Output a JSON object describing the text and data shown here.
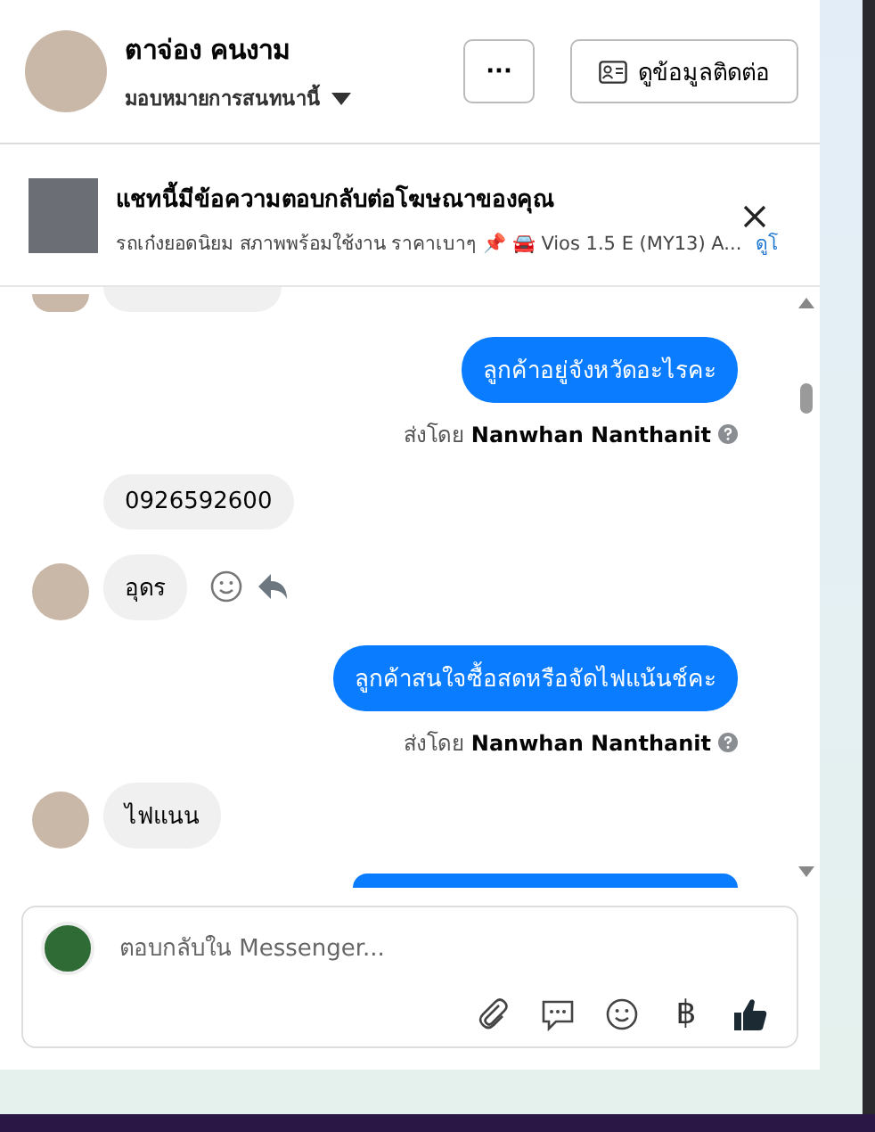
{
  "header": {
    "name": "ตาจ่อง คนงาม",
    "assign_label": "มอบหมายการสนทนานี้",
    "more_button": "···",
    "contact_button": "ดูข้อมูลติดต่อ"
  },
  "ad_banner": {
    "title": "แชทนี้มีข้อความตอบกลับต่อโฆษณาของคุณ",
    "subtitle": "รถเก๋งยอดนิยม สภาพพร้อมใช้งาน ราคาเบาๆ 📌 🚘 Vios 1.5 E (MY13) A...",
    "link": "ดูโ"
  },
  "messages": [
    {
      "kind": "incoming",
      "partial": true,
      "avatar": true
    },
    {
      "kind": "outgoing",
      "text": "ลูกค้าอยู่จังหวัดอะไรคะ",
      "sent_by": "ส่งโดย **Nanwhan Nanthanit**"
    },
    {
      "kind": "incoming",
      "text": "0926592600",
      "avatar": false
    },
    {
      "kind": "incoming",
      "text": "อุดร",
      "avatar": true,
      "actions": true
    },
    {
      "kind": "outgoing",
      "text": "ลูกค้าสนใจซื้อสดหรือจัดไฟแน้นช์คะ",
      "sent_by": "ส่งโดย **Nanwhan Nanthanit**"
    },
    {
      "kind": "incoming",
      "text": "ไฟแนน",
      "avatar": true
    },
    {
      "kind": "outgoing",
      "partial": true
    }
  ],
  "composer": {
    "placeholder": "ตอบกลับใน Messenger...",
    "baht": "฿"
  }
}
